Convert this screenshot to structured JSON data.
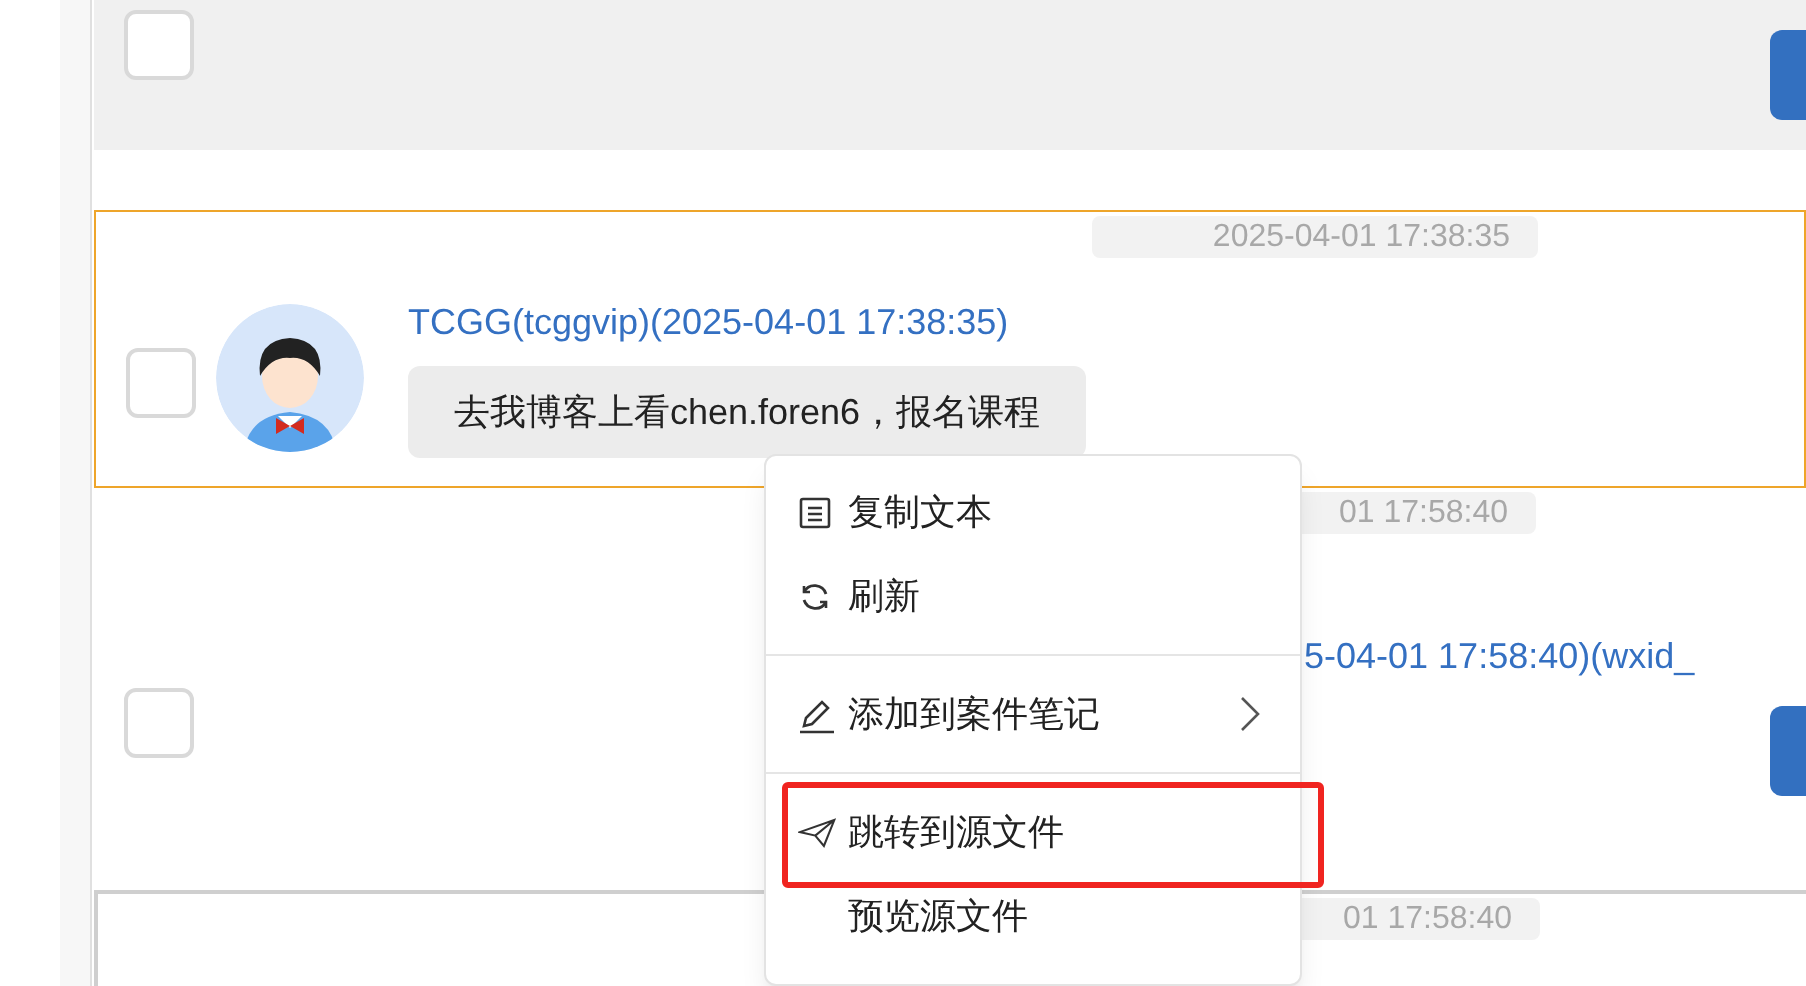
{
  "messages": [
    {
      "highlighted": true,
      "selected": false,
      "checked": false
    },
    {
      "highlighted": false,
      "selected": true,
      "checked": false,
      "timestamp": "2025-04-01 17:38:35",
      "sender": "TCGG(tcggvip)(2025-04-01 17:38:35)",
      "text": "去我博客上看chen.foren6，报名课程"
    },
    {
      "highlighted": false,
      "selected": false,
      "checked": false,
      "timestamp": "01 17:58:40",
      "sender": "5-04-01 17:58:40)(wxid_"
    },
    {
      "highlighted": false,
      "selected": false,
      "timestamp": "01 17:58:40"
    }
  ],
  "context_menu": {
    "groups": [
      [
        {
          "label": "复制文本",
          "has_submenu": false,
          "annotated": false
        },
        {
          "label": "刷新",
          "has_submenu": false,
          "annotated": false
        }
      ],
      [
        {
          "label": "添加到案件笔记",
          "has_submenu": true,
          "annotated": false
        }
      ],
      [
        {
          "label": "跳转到源文件",
          "has_submenu": false,
          "annotated": true
        },
        {
          "label": "预览源文件",
          "has_submenu": false,
          "annotated": false
        }
      ]
    ]
  }
}
